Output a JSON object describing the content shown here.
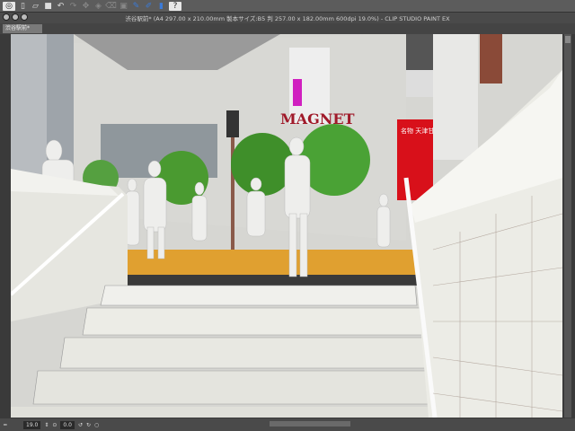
{
  "toolbar": {
    "icons": [
      "view-icon",
      "new-file-icon",
      "open-icon",
      "save-icon",
      "undo-icon",
      "redo-icon",
      "transform-icon",
      "fill-icon",
      "clear-icon",
      "layer-icon",
      "pen-icon",
      "brush-icon",
      "eraser-icon",
      "help-icon"
    ]
  },
  "window": {
    "title": "渋谷駅前* (A4 297.00 x 210.00mm 製本サイズ:B5 判 257.00 x 182.00mm 600dpi 19.0%) - CLIP STUDIO PAINT EX"
  },
  "tab": {
    "label": "渋谷駅前*"
  },
  "scene": {
    "sign_magnet": "MAGNET",
    "sign_red": "名物 天津甘"
  },
  "status": {
    "zoom": "19.0",
    "rotation": "0.0"
  }
}
